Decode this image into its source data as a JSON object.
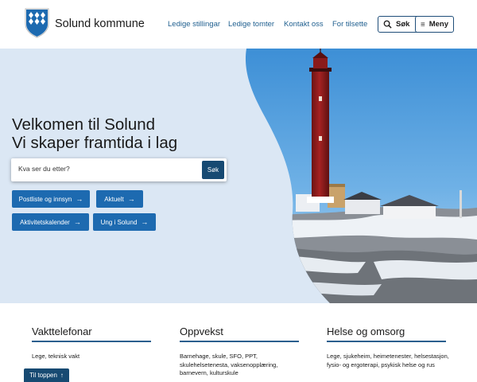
{
  "header": {
    "brand": "Solund kommune",
    "nav": [
      "Ledige stillingar",
      "Ledige tomter",
      "Kontakt oss",
      "For tilsette"
    ],
    "search_label": "Søk",
    "menu_label": "Meny"
  },
  "hero": {
    "title_line1": "Velkomen til Solund",
    "title_line2": "Vi skaper framtida i lag",
    "search_placeholder": "Kva ser du etter?",
    "search_button": "Søk",
    "quick_links": [
      "Postliste og innsyn",
      "Aktuelt",
      "Aktivitetskalender",
      "Ung i Solund"
    ]
  },
  "sections": [
    {
      "title": "Vakttelefonar",
      "text": "Lege, teknisk vakt"
    },
    {
      "title": "Oppvekst",
      "text": "Barnehage, skule, SFO, PPT, skulehelsetenesta, vaksenopplæring, barnevern, kulturskule"
    },
    {
      "title": "Helse og omsorg",
      "text": "Lege, sjukeheim, heimetenester, helsestasjon, fysio- og ergoterapi, psykisk helse og rus"
    }
  ],
  "to_top": "Til toppen",
  "colors": {
    "primary": "#1d6ab0",
    "dark": "#174a72",
    "hero_bg": "#dbe7f4",
    "link": "#1f5f8f"
  },
  "icons": [
    "coat-of-arms-icon",
    "search-icon",
    "menu-icon",
    "arrow-right-icon",
    "arrow-up-icon"
  ]
}
